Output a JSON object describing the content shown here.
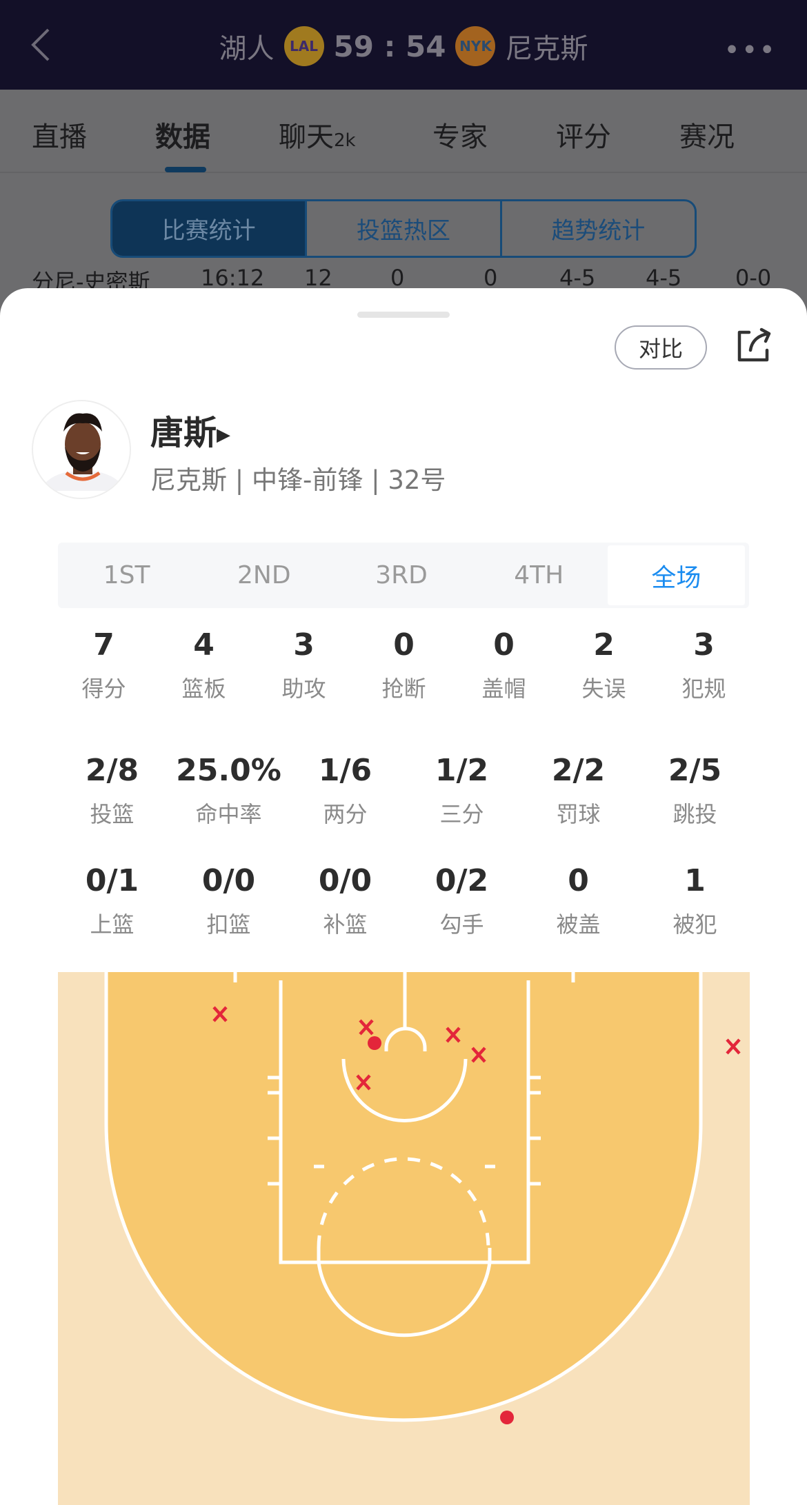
{
  "header": {
    "home_team": "湖人",
    "home_logo": "LAL",
    "score": "59 : 54",
    "away_logo": "NYK",
    "away_team": "尼克斯",
    "back_icon": "chevron-left-icon",
    "more_icon": "more-icon"
  },
  "tabs": [
    {
      "label": "直播"
    },
    {
      "label": "数据",
      "active": true
    },
    {
      "label": "聊天",
      "badge": "2k"
    },
    {
      "label": "专家"
    },
    {
      "label": "评分"
    },
    {
      "label": "赛况"
    }
  ],
  "segments": [
    {
      "label": "比赛统计",
      "active": true
    },
    {
      "label": "投篮热区"
    },
    {
      "label": "趋势统计"
    }
  ],
  "peek_row": [
    "分尼-史密斯",
    "16:12",
    "12",
    "0",
    "0",
    "4-5",
    "4-5",
    "0-0"
  ],
  "sheet": {
    "compare_label": "对比",
    "share_icon": "share-icon",
    "player": {
      "name": "唐斯",
      "info": "尼克斯 | 中锋-前锋 | 32号"
    },
    "periods": [
      {
        "label": "1ST"
      },
      {
        "label": "2ND"
      },
      {
        "label": "3RD"
      },
      {
        "label": "4TH"
      },
      {
        "label": "全场",
        "active": true
      }
    ],
    "stats_row1": [
      {
        "value": "7",
        "label": "得分"
      },
      {
        "value": "4",
        "label": "篮板"
      },
      {
        "value": "3",
        "label": "助攻"
      },
      {
        "value": "0",
        "label": "抢断"
      },
      {
        "value": "0",
        "label": "盖帽"
      },
      {
        "value": "2",
        "label": "失误"
      },
      {
        "value": "3",
        "label": "犯规"
      }
    ],
    "stats_row2": [
      {
        "value": "2/8",
        "label": "投篮"
      },
      {
        "value": "25.0%",
        "label": "命中率"
      },
      {
        "value": "1/6",
        "label": "两分"
      },
      {
        "value": "1/2",
        "label": "三分"
      },
      {
        "value": "2/2",
        "label": "罚球"
      },
      {
        "value": "2/5",
        "label": "跳投"
      }
    ],
    "stats_row3": [
      {
        "value": "0/1",
        "label": "上篮"
      },
      {
        "value": "0/0",
        "label": "扣篮"
      },
      {
        "value": "0/0",
        "label": "补篮"
      },
      {
        "value": "0/2",
        "label": "勾手"
      },
      {
        "value": "0",
        "label": "被盖"
      },
      {
        "value": "1",
        "label": "被犯"
      }
    ]
  },
  "shot_chart": {
    "colors": {
      "paint": "#f7c86e",
      "outside": "#f8e1bc",
      "lines": "#ffffff",
      "marker": "#e3263a",
      "accent": "#1b8cf0"
    },
    "shots": [
      "missed",
      "missed",
      "made",
      "missed",
      "missed",
      "missed",
      "missed",
      "made"
    ]
  }
}
